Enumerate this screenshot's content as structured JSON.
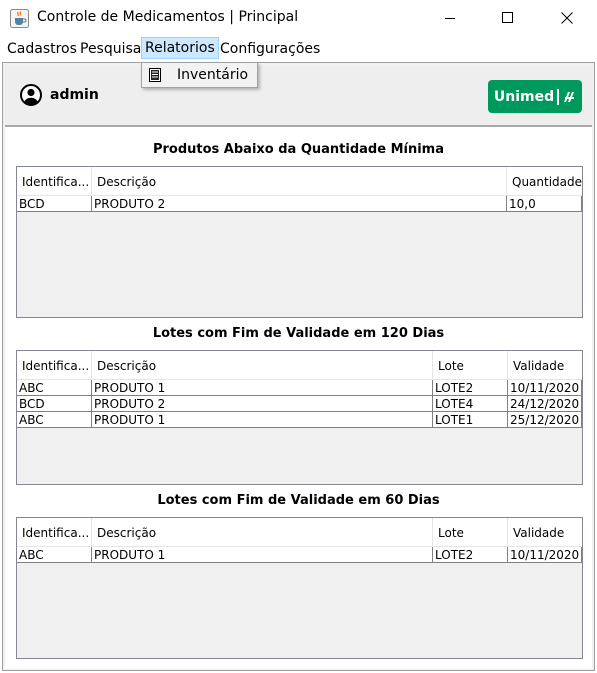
{
  "window": {
    "title": "Controle de Medicamentos | Principal",
    "icons": [
      "java-cup-icon",
      "minimize-icon",
      "maximize-icon",
      "close-icon"
    ]
  },
  "menubar": {
    "items": [
      {
        "label": "Cadastros"
      },
      {
        "label": "Pesquisa"
      },
      {
        "label": "Relatorios",
        "active": true
      },
      {
        "label": "Configurações"
      }
    ]
  },
  "dropdown": {
    "items": [
      {
        "label": "Inventário",
        "icon": "report-icon"
      }
    ]
  },
  "header": {
    "user_icon": "user-icon",
    "username": "admin",
    "logo": {
      "text": "Unimed",
      "color": "#00995d"
    }
  },
  "sections": [
    {
      "title": "Produtos Abaixo da Quantidade Mínima",
      "columns": [
        "Identifica...",
        "Descrição",
        "Quantidade"
      ],
      "rows": [
        [
          "BCD",
          "PRODUTO 2",
          "10,0"
        ]
      ]
    },
    {
      "title": "Lotes com Fim de Validade em 120 Dias",
      "columns": [
        "Identifica...",
        "Descrição",
        "Lote",
        "Validade"
      ],
      "rows": [
        [
          "ABC",
          "PRODUTO 1",
          "LOTE2",
          "10/11/2020"
        ],
        [
          "BCD",
          "PRODUTO 2",
          "LOTE4",
          "24/12/2020"
        ],
        [
          "ABC",
          "PRODUTO 1",
          "LOTE1",
          "25/12/2020"
        ]
      ]
    },
    {
      "title": "Lotes com Fim de Validade em 60 Dias",
      "columns": [
        "Identifica...",
        "Descrição",
        "Lote",
        "Validade"
      ],
      "rows": [
        [
          "ABC",
          "PRODUTO 1",
          "LOTE2",
          "10/11/2020"
        ]
      ]
    }
  ]
}
